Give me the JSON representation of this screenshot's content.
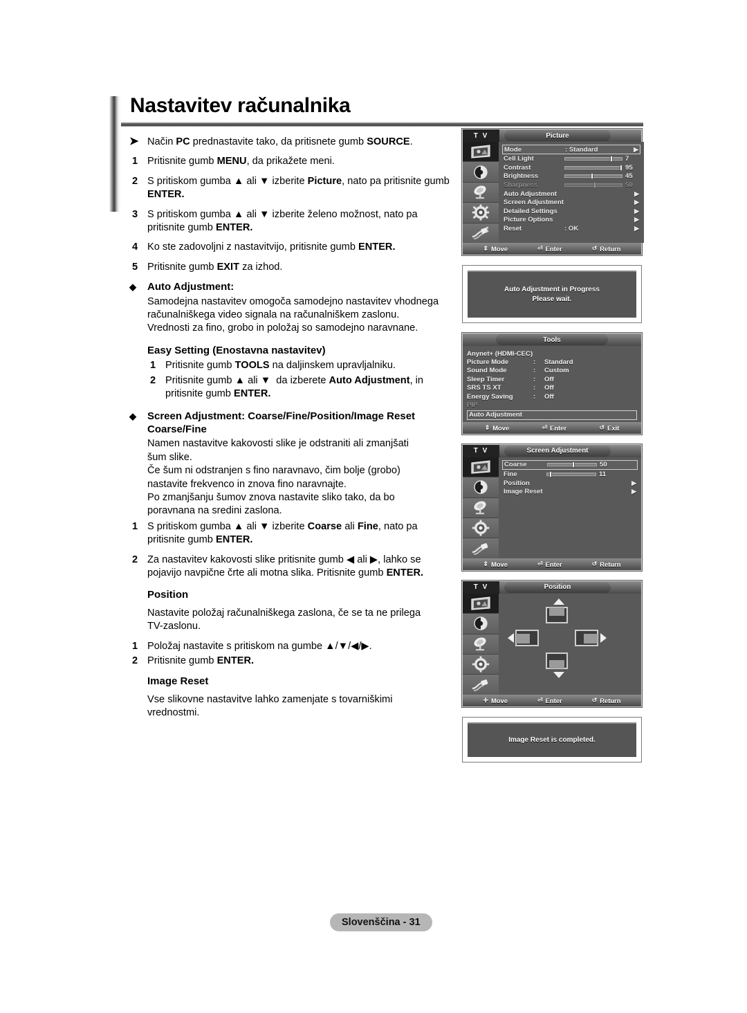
{
  "document": {
    "title": "Nastavitev računalnika",
    "footer_label": "Slovenščina - 31"
  },
  "instructions": {
    "note_marker": "➤",
    "note_text_parts": [
      "Način ",
      "PC",
      " prednastavite tako, da pritisnete gumb ",
      "SOURCE",
      "."
    ],
    "steps": [
      {
        "num": "1",
        "parts": [
          "Pritisnite gumb ",
          "MENU",
          ", da prikažete meni."
        ]
      },
      {
        "num": "2",
        "parts": [
          "S pritiskom gumba ▲ ali ▼ izberite ",
          "Picture",
          ", nato pa pritisnite gumb ",
          "ENTER",
          "."
        ]
      },
      {
        "num": "3",
        "parts": [
          "S pritiskom gumba ▲ ali ▼ izberite želeno možnost, nato pa pritisnite gumb ",
          "ENTER",
          "."
        ]
      },
      {
        "num": "4",
        "parts": [
          "Ko ste zadovoljni z nastavitvijo, pritisnite gumb ",
          "ENTER",
          "."
        ]
      },
      {
        "num": "5",
        "parts": [
          "Pritisnite gumb ",
          "EXIT",
          " za izhod."
        ]
      }
    ]
  },
  "sections": {
    "auto_adjustment": {
      "marker": "◆",
      "heading": "Auto Adjustment:",
      "body_lines": [
        "Samodejna nastavitev omogoča samodejno nastavitev vhodnega",
        "računalniškega video signala na računalniškem zaslonu.",
        "Vrednosti za fino, grobo in položaj so samodejno naravnane."
      ],
      "easy_setting_heading": "Easy Setting (Enostavna nastavitev)",
      "easy_steps": [
        {
          "num": "1",
          "parts": [
            "Pritisnite gumb ",
            "TOOLS",
            " na daljinskem upravljalniku."
          ]
        },
        {
          "num": "2",
          "parts": [
            "Pritisnite gumb ▲ ali ▼  da izberete ",
            "Auto Adjustment",
            ", in pritisnite gumb ",
            "ENTER",
            "."
          ]
        }
      ]
    },
    "screen_adjustment": {
      "marker": "◆",
      "heading_line1": "Screen Adjustment: Coarse/Fine/Position/Image Reset",
      "heading_line2": "Coarse/Fine",
      "body_lines": [
        "Namen nastavitve kakovosti slike je odstraniti ali zmanjšati",
        "šum slike.",
        "Če šum ni odstranjen s fino naravnavo, čim bolje (grobo)",
        "nastavite frekvenco in znova fino naravnajte.",
        "Po zmanjšanju šumov znova nastavite sliko tako, da bo",
        "poravnana na sredini zaslona."
      ],
      "steps": [
        {
          "num": "1",
          "parts": [
            "S pritiskom gumba ▲ ali ▼ izberite ",
            "Coarse",
            " ali ",
            "Fine",
            ", nato pa pritisnite gumb ",
            "ENTER",
            "."
          ]
        },
        {
          "num": "2",
          "parts": [
            "Za nastavitev kakovosti slike pritisnite gumb ◀ ali ▶, lahko se pojavijo navpične črte ali motna slika. Pritisnite gumb ",
            "ENTER",
            "."
          ]
        }
      ]
    },
    "position": {
      "heading": "Position",
      "body_lines": [
        "Nastavite položaj računalniškega zaslona, če se ta ne prilega",
        "TV-zaslonu."
      ],
      "steps": [
        {
          "num": "1",
          "parts": [
            "Položaj nastavite s pritiskom na gumbe ▲/▼/◀/▶."
          ]
        },
        {
          "num": "2",
          "parts": [
            "Pritisnite gumb ",
            "ENTER",
            "."
          ]
        }
      ]
    },
    "image_reset": {
      "heading": "Image Reset",
      "body_lines": [
        "Vse slikovne nastavitve lahko zamenjate s tovarniškimi",
        "vrednostmi."
      ]
    }
  },
  "osd": {
    "tv_tag": "T V",
    "rail_icons": [
      "picture-icon",
      "sound-icon",
      "channel-icon",
      "setup-icon",
      "input-icon"
    ],
    "picture_menu": {
      "title": "Picture",
      "rows": [
        {
          "label": "Mode",
          "type": "value",
          "colon": ":",
          "value": "Standard",
          "arrow": "▶",
          "selected": true
        },
        {
          "label": "Cell Light",
          "type": "slider",
          "value": "7",
          "fill": 78,
          "dim": false
        },
        {
          "label": "Contrast",
          "type": "slider",
          "value": "95",
          "fill": 95,
          "dim": false
        },
        {
          "label": "Brightness",
          "type": "slider",
          "value": "45",
          "fill": 45,
          "dim": false
        },
        {
          "label": "Sharpness",
          "type": "slider",
          "value": "50",
          "fill": 50,
          "dim": true
        },
        {
          "label": "Auto Adjustment",
          "type": "arrow",
          "arrow": "▶"
        },
        {
          "label": "Screen Adjustment",
          "type": "arrow",
          "arrow": "▶"
        },
        {
          "label": "Detailed Settings",
          "type": "arrow",
          "arrow": "▶"
        },
        {
          "label": "Picture Options",
          "type": "arrow",
          "arrow": "▶"
        },
        {
          "label": "Reset",
          "type": "value",
          "colon": ":",
          "value": "OK",
          "arrow": "▶"
        }
      ],
      "hints": [
        {
          "glyph": "⇕",
          "label": "Move"
        },
        {
          "glyph": "⏎",
          "label": "Enter"
        },
        {
          "glyph": "↺",
          "label": "Return"
        }
      ]
    },
    "auto_adjust_message": {
      "line1": "Auto Adjustment in Progress",
      "line2": "Please wait."
    },
    "tools_menu": {
      "title": "Tools",
      "rows": [
        {
          "label": "Anynet+ (HDMI-CEC)",
          "colon": "",
          "value": "",
          "dim": false
        },
        {
          "label": "Picture Mode",
          "colon": ":",
          "value": "Standard",
          "dim": false
        },
        {
          "label": "Sound Mode",
          "colon": ":",
          "value": "Custom",
          "dim": false
        },
        {
          "label": "Sleep Timer",
          "colon": ":",
          "value": "Off",
          "dim": false
        },
        {
          "label": "SRS TS XT",
          "colon": ":",
          "value": "Off",
          "dim": false
        },
        {
          "label": "Energy Saving",
          "colon": ":",
          "value": "Off",
          "dim": false
        },
        {
          "label": "PIP",
          "colon": "",
          "value": "",
          "dim": true
        }
      ],
      "selected_row": "Auto Adjustment",
      "hints": [
        {
          "glyph": "⇕",
          "label": "Move"
        },
        {
          "glyph": "⏎",
          "label": "Enter"
        },
        {
          "glyph": "↺",
          "label": "Exit"
        }
      ]
    },
    "screen_adjust_menu": {
      "title": "Screen Adjustment",
      "rows": [
        {
          "label": "Coarse",
          "type": "slider",
          "value": "50",
          "fill": 50,
          "selected": true
        },
        {
          "label": "Fine",
          "type": "slider",
          "value": "11",
          "fill": 6,
          "selected": false
        },
        {
          "label": "Position",
          "type": "arrow",
          "arrow": "▶"
        },
        {
          "label": "Image Reset",
          "type": "arrow",
          "arrow": "▶"
        }
      ],
      "hints": [
        {
          "glyph": "⇕",
          "label": "Move"
        },
        {
          "glyph": "⏎",
          "label": "Enter"
        },
        {
          "glyph": "↺",
          "label": "Return"
        }
      ]
    },
    "position_menu": {
      "title": "Position",
      "hints": [
        {
          "glyph": "✛",
          "label": "Move"
        },
        {
          "glyph": "⏎",
          "label": "Enter"
        },
        {
          "glyph": "↺",
          "label": "Return"
        }
      ]
    },
    "image_reset_message": {
      "line1": "Image Reset is completed."
    }
  }
}
